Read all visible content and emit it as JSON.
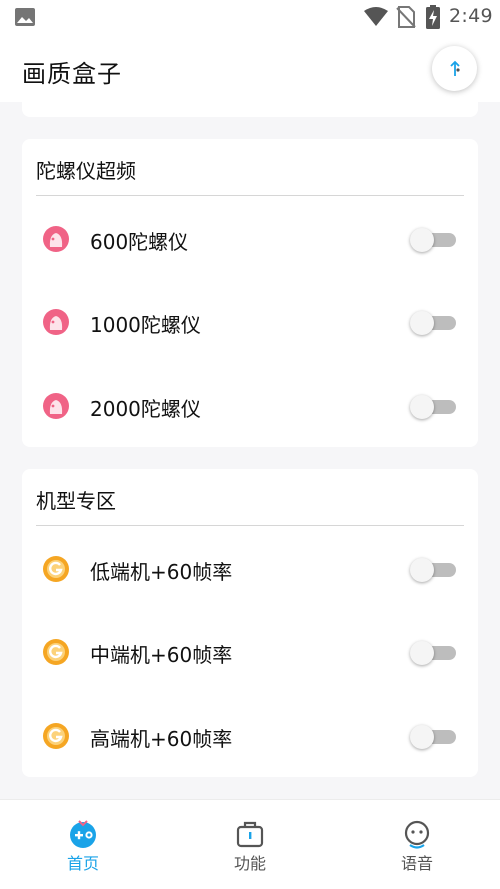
{
  "status_bar": {
    "time": "2:49",
    "icons": [
      "image-icon",
      "wifi-icon",
      "no-sim-icon",
      "battery-charging-icon"
    ]
  },
  "header": {
    "title": "画质盒子",
    "action_icon": "compass-icon"
  },
  "sections": [
    {
      "title": "陀螺仪超频",
      "icon": "pink-blob-icon",
      "items": [
        {
          "label": "600陀螺仪",
          "enabled": false
        },
        {
          "label": "1000陀螺仪",
          "enabled": false
        },
        {
          "label": "2000陀螺仪",
          "enabled": false
        }
      ]
    },
    {
      "title": "机型专区",
      "icon": "orange-g-icon",
      "items": [
        {
          "label": "低端机+60帧率",
          "enabled": false
        },
        {
          "label": "中端机+60帧率",
          "enabled": false
        },
        {
          "label": "高端机+60帧率",
          "enabled": false
        }
      ]
    }
  ],
  "bottom_nav": {
    "items": [
      {
        "label": "首页",
        "icon": "gamepad-icon",
        "active": true
      },
      {
        "label": "功能",
        "icon": "toolbox-icon",
        "active": false
      },
      {
        "label": "语音",
        "icon": "face-icon",
        "active": false
      }
    ]
  },
  "colors": {
    "accent": "#1aa3e8",
    "pink": "#f06386",
    "orange": "#f5a623",
    "toggle_off_track": "#bdbdbd"
  }
}
